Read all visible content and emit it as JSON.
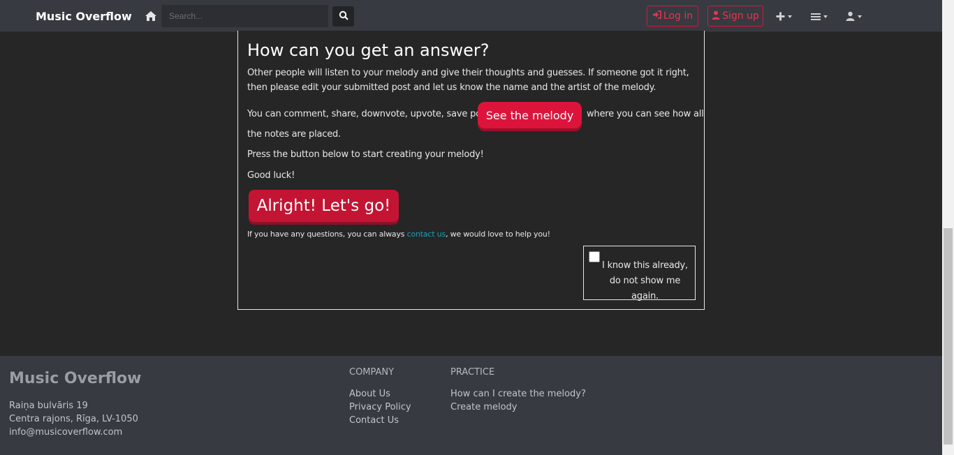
{
  "navbar": {
    "brand": "Music Overflow",
    "search_placeholder": "Search...",
    "login_label": "Log in",
    "signup_label": "Sign up",
    "icons": [
      "home-icon",
      "search-icon",
      "sign-in-icon",
      "user-icon",
      "plus-icon",
      "bars-icon",
      "user-icon"
    ]
  },
  "modal": {
    "title": "How can you get an answer?",
    "paragraph1": "Other people will listen to your melody and give their thoughts and guesses. If someone got it right, then please edit your submitted post and let us know the name and the artist of the melody.",
    "paragraph2_start": "You can comment, share, downvote, upvote, save posts,",
    "see_melody_label": "See the melody",
    "paragraph2_end_line1": "where you can see how all",
    "paragraph2_end_line2": "the notes are placed.",
    "paragraph3": "Press the button below to start creating your melody!",
    "paragraph4": "Good luck!",
    "go_label": "Alright! Let's go!",
    "note_prefix": "If you have any questions, you can always ",
    "note_link": "contact us",
    "note_suffix": ", we would love to help you!",
    "dont_show_label": "I know this already, do not show me again.",
    "dont_show_checked": false
  },
  "footer": {
    "brand": "Music Overflow",
    "address_line1": "Raiņa bulvāris 19",
    "address_line2": "Centra rajons, Rīga, LV-1050",
    "email": "info@musicoverflow.com",
    "company_heading": "COMPANY",
    "company_links": [
      "About Us",
      "Privacy Policy",
      "Contact Us"
    ],
    "practice_heading": "PRACTICE",
    "practice_links": [
      "How can I create the melody?",
      "Create melody"
    ]
  },
  "colors": {
    "accent": "#dc143c",
    "link": "#17a2b8",
    "navbar_bg": "#373a40",
    "page_bg": "#262626"
  }
}
